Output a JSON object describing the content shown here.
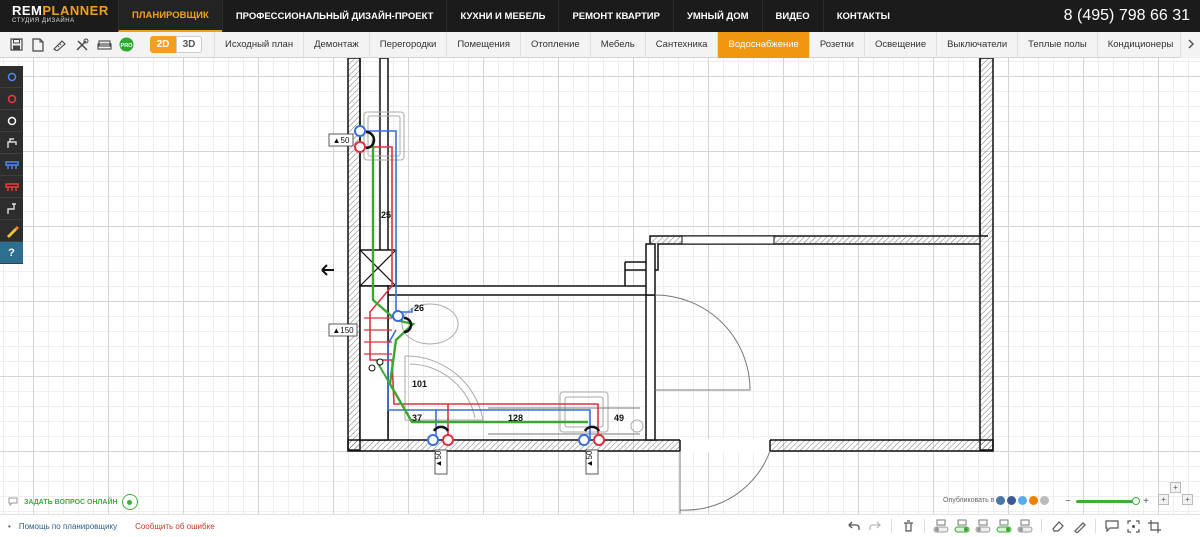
{
  "brand": {
    "logo_main": "REM",
    "logo_accent": "PLANNER",
    "logo_sub": "СТУДИЯ ДИЗАЙНА"
  },
  "nav": {
    "items": [
      {
        "label": "ПЛАНИРОВЩИК",
        "active": true
      },
      {
        "label": "ПРОФЕССИОНАЛЬНЫЙ ДИЗАЙН-ПРОЕКТ",
        "active": false
      },
      {
        "label": "КУХНИ И МЕБЕЛЬ",
        "active": false
      },
      {
        "label": "РЕМОНТ КВАРТИР",
        "active": false
      },
      {
        "label": "УМНЫЙ ДОМ",
        "active": false
      },
      {
        "label": "ВИДЕО",
        "active": false
      },
      {
        "label": "КОНТАКТЫ",
        "active": false
      }
    ],
    "phone": "8 (495) 798 66 31"
  },
  "toolbar": {
    "icons": [
      "save-icon",
      "document-icon",
      "measure-icon",
      "tools-icon",
      "sofa-icon",
      "pro-badge-icon"
    ],
    "pro_label": "PRO",
    "mode_2d": "2D",
    "mode_3d": "3D",
    "tabs": [
      {
        "label": "Исходный план",
        "active": false
      },
      {
        "label": "Демонтаж",
        "active": false
      },
      {
        "label": "Перегородки",
        "active": false
      },
      {
        "label": "Помещения",
        "active": false
      },
      {
        "label": "Отопление",
        "active": false
      },
      {
        "label": "Мебель",
        "active": false
      },
      {
        "label": "Сантехника",
        "active": false
      },
      {
        "label": "Водоснабжение",
        "active": true
      },
      {
        "label": "Розетки",
        "active": false
      },
      {
        "label": "Освещение",
        "active": false
      },
      {
        "label": "Выключатели",
        "active": false
      },
      {
        "label": "Теплые полы",
        "active": false
      },
      {
        "label": "Кондиционеры",
        "active": false
      }
    ],
    "more_icon": "chevron-right-icon"
  },
  "left_panel": {
    "tools": [
      "cold-water-point-icon",
      "hot-water-point-icon",
      "drain-point-icon",
      "faucet-icon",
      "cold-collector-icon",
      "hot-collector-icon",
      "pipe-bend-icon",
      "pencil-icon"
    ],
    "help_label": "?"
  },
  "plan": {
    "labels": {
      "elev_top": "▲50",
      "elev_mid": "▲150",
      "elev_bottom_left": "▲50",
      "elev_bottom_right": "▲50",
      "len_25": "25",
      "len_26": "26",
      "len_101": "101",
      "len_37": "37",
      "len_128": "128",
      "len_49": "49"
    },
    "colors": {
      "cold": "#3a6fd8",
      "hot": "#e03040",
      "drain": "#3aa830",
      "wall": "#111111"
    }
  },
  "bottom": {
    "ask_label": "ЗАДАТЬ ВОПРОС ОНЛАЙН",
    "publish_label": "Опубликовать в",
    "zoom_minus": "−",
    "zoom_plus": "+",
    "zoom_level": 0.9
  },
  "footer": {
    "help_link": "Помощь по планировщику",
    "bug_link": "Сообщить об ошибке",
    "tools": [
      "undo-icon",
      "redo-icon",
      "trash-icon",
      "layer-toggle-1-icon",
      "layer-toggle-2-icon",
      "layer-toggle-3-icon",
      "layer-toggle-4-icon",
      "layer-toggle-5-icon",
      "eraser-icon",
      "pencil-icon",
      "comment-icon",
      "fullscreen-icon",
      "crop-icon"
    ]
  }
}
